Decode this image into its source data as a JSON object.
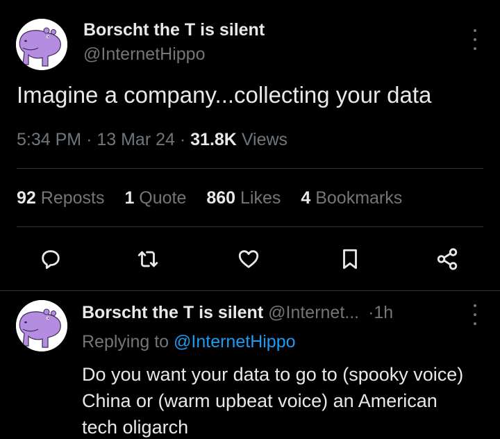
{
  "tweet": {
    "author_name": "Borscht the T is silent",
    "author_handle": "@InternetHippo",
    "text": "Imagine a company...collecting your data",
    "time": "5:34 PM",
    "separator": "·",
    "date": "13 Mar 24",
    "views_count": "31.8K",
    "views_label": "Views",
    "stats": [
      {
        "count": "92",
        "label": "Reposts"
      },
      {
        "count": "1",
        "label": "Quote"
      },
      {
        "count": "860",
        "label": "Likes"
      },
      {
        "count": "4",
        "label": "Bookmarks"
      }
    ],
    "actions": [
      "reply-icon",
      "repost-icon",
      "like-icon",
      "bookmark-icon",
      "share-icon"
    ]
  },
  "reply": {
    "author_name": "Borscht the T is silent",
    "author_handle": "@Internet...",
    "separator": "·",
    "time": "1h",
    "replying_label": "Replying to",
    "replying_handle": "@InternetHippo",
    "lines": [
      "Do you want your data to go to (spooky voice)",
      "China or (warm upbeat voice) an American",
      "tech oligarch"
    ]
  },
  "colors": {
    "background": "#000000",
    "text_primary": "#e7e9ea",
    "text_secondary": "#71767b",
    "link": "#1d9bf0",
    "divider": "#2f3336",
    "avatar_hippo": "#b48ce0"
  }
}
